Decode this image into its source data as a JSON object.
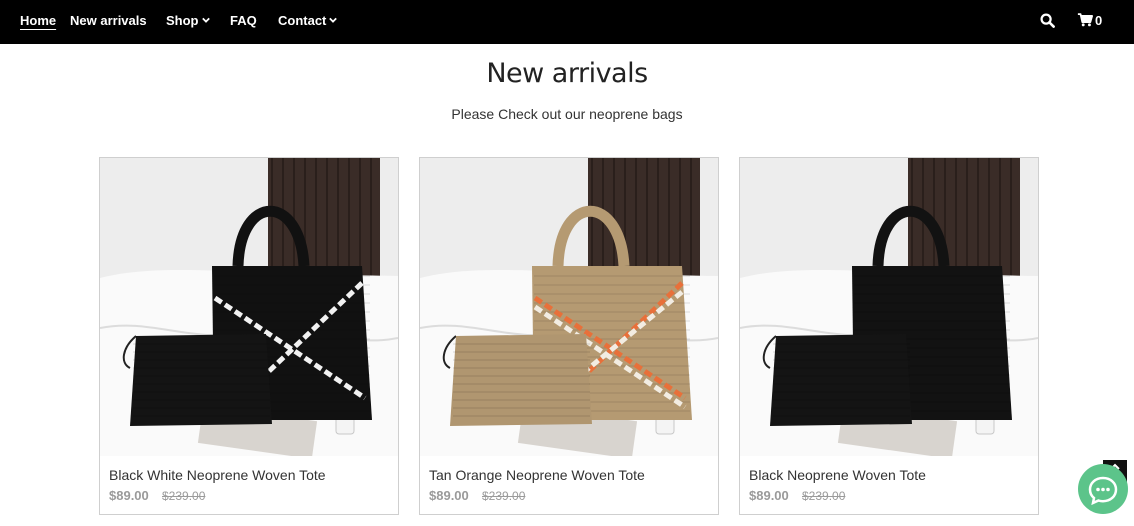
{
  "nav": {
    "home": "Home",
    "new_arrivals": "New arrivals",
    "shop": "Shop",
    "faq": "FAQ",
    "contact": "Contact",
    "cart_count": "0",
    "icons": [
      "search-icon",
      "cart-icon",
      "chevron-down-icon"
    ]
  },
  "section": {
    "title": "New arrivals",
    "subtitle": "Please Check out our neoprene bags"
  },
  "products": [
    {
      "name": "Black White Neoprene Woven Tote",
      "price": "$89.00",
      "old_price": "$239.00",
      "tote_color": "#111111",
      "pouch_color": "#141414",
      "stripe_colors": [
        "#f2f2f2"
      ]
    },
    {
      "name": "Tan Orange Neoprene Woven Tote",
      "price": "$89.00",
      "old_price": "$239.00",
      "tote_color": "#b59a72",
      "pouch_color": "#b09670",
      "stripe_colors": [
        "#e8703a",
        "#f2ece2"
      ]
    },
    {
      "name": "Black Neoprene Woven Tote",
      "price": "$89.00",
      "old_price": "$239.00",
      "tote_color": "#121212",
      "pouch_color": "#141414",
      "stripe_colors": []
    }
  ],
  "floaters": {
    "chat_color": "#5cc48a",
    "icons": [
      "chevron-up-icon",
      "chat-icon"
    ]
  }
}
